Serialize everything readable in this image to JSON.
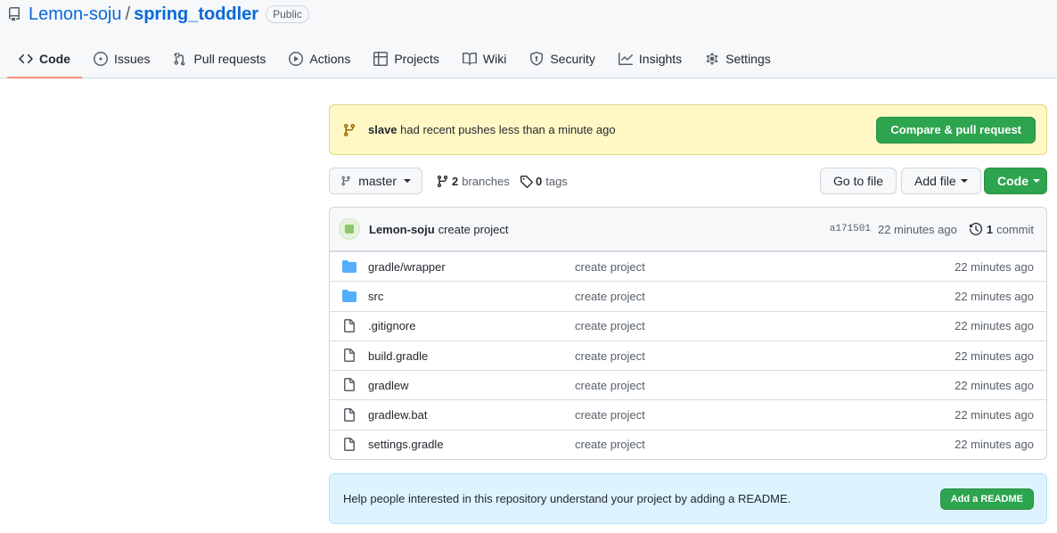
{
  "repo": {
    "owner": "Lemon-soju",
    "separator": "/",
    "name": "spring_toddler",
    "visibility": "Public"
  },
  "tabs": [
    {
      "label": "Code",
      "icon": "code-icon",
      "selected": true
    },
    {
      "label": "Issues",
      "icon": "issue-opened-icon"
    },
    {
      "label": "Pull requests",
      "icon": "git-pull-request-icon"
    },
    {
      "label": "Actions",
      "icon": "play-icon"
    },
    {
      "label": "Projects",
      "icon": "table-icon"
    },
    {
      "label": "Wiki",
      "icon": "book-icon"
    },
    {
      "label": "Security",
      "icon": "shield-icon"
    },
    {
      "label": "Insights",
      "icon": "graph-icon"
    },
    {
      "label": "Settings",
      "icon": "gear-icon"
    }
  ],
  "push_banner": {
    "branch": "slave",
    "message": "had recent pushes less than a minute ago",
    "button": "Compare & pull request"
  },
  "file_nav": {
    "branch": "master",
    "branches_count": "2",
    "branches_label": "branches",
    "tags_count": "0",
    "tags_label": "tags",
    "go_to_file": "Go to file",
    "add_file": "Add file",
    "code": "Code"
  },
  "commit": {
    "author": "Lemon-soju",
    "message": "create project",
    "sha": "a171501",
    "age": "22 minutes ago",
    "count": "1",
    "count_label": "commit"
  },
  "files": [
    {
      "name": "gradle/wrapper",
      "type": "folder",
      "message": "create project",
      "age": "22 minutes ago"
    },
    {
      "name": "src",
      "type": "folder",
      "message": "create project",
      "age": "22 minutes ago"
    },
    {
      "name": ".gitignore",
      "type": "file",
      "message": "create project",
      "age": "22 minutes ago"
    },
    {
      "name": "build.gradle",
      "type": "file",
      "message": "create project",
      "age": "22 minutes ago"
    },
    {
      "name": "gradlew",
      "type": "file",
      "message": "create project",
      "age": "22 minutes ago"
    },
    {
      "name": "gradlew.bat",
      "type": "file",
      "message": "create project",
      "age": "22 minutes ago"
    },
    {
      "name": "settings.gradle",
      "type": "file",
      "message": "create project",
      "age": "22 minutes ago"
    }
  ],
  "readme_banner": {
    "message": "Help people interested in this repository understand your project by adding a README.",
    "button": "Add a README"
  },
  "colors": {
    "link": "#0969da",
    "green_button": "#2da44e",
    "push_banner_bg": "#fff8c5",
    "readme_banner_bg": "#ddf4ff",
    "folder": "#54aeff",
    "tab_underline": "#fd8c73"
  }
}
